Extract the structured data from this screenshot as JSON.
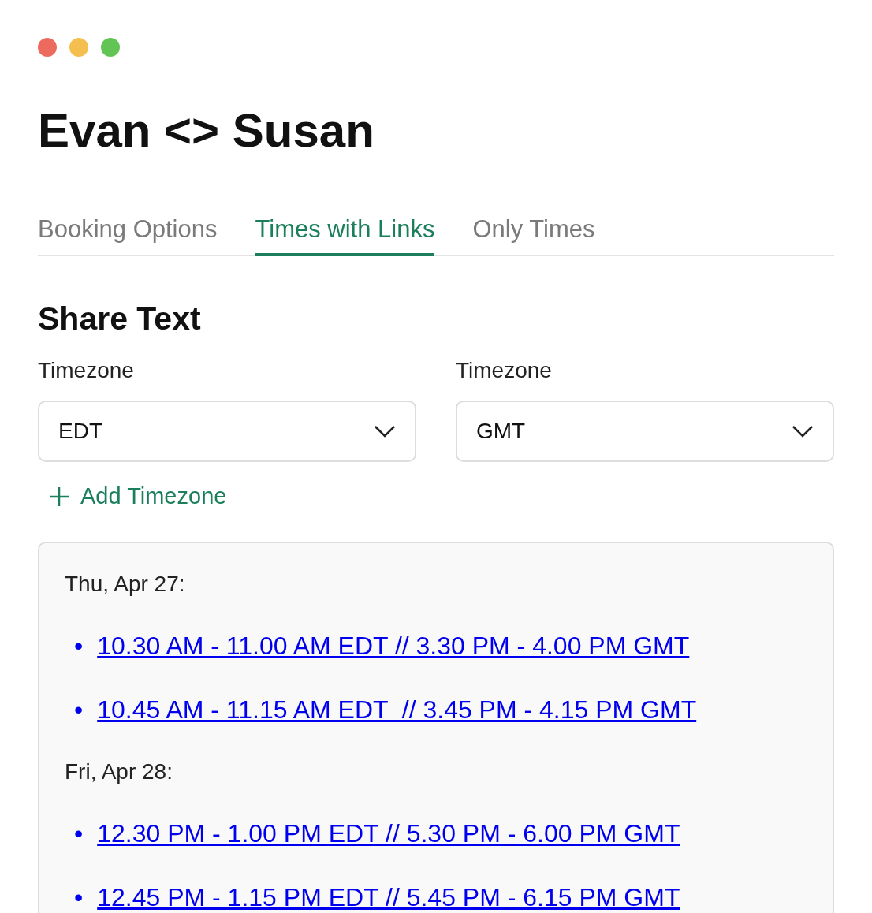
{
  "title": "Evan <> Susan",
  "tabs": [
    {
      "label": "Booking Options",
      "selected": false
    },
    {
      "label": "Times with Links",
      "selected": true
    },
    {
      "label": "Only Times",
      "selected": false
    }
  ],
  "section_title": "Share Text",
  "timezones": [
    {
      "label": "Timezone",
      "value": "EDT"
    },
    {
      "label": "Timezone",
      "value": "GMT"
    }
  ],
  "add_timezone": "Add Timezone",
  "days": [
    {
      "date": "Thu, Apr 27:",
      "times": [
        {
          "bullet": "•",
          "text": "10.30 AM - 11.00 AM EDT // 3.30 PM - 4.00 PM GMT"
        },
        {
          "bullet": "•",
          "text": "10.45 AM - 11.15 AM EDT  // 3.45 PM - 4.15 PM GMT"
        }
      ]
    },
    {
      "date": "Fri, Apr 28:",
      "times": [
        {
          "bullet": "•",
          "text": "12.30 PM - 1.00 PM EDT // 5.30 PM - 6.00 PM GMT"
        },
        {
          "bullet": "•",
          "text": "12.45 PM - 1.15 PM EDT // 5.45 PM - 6.15 PM GMT"
        }
      ]
    }
  ]
}
